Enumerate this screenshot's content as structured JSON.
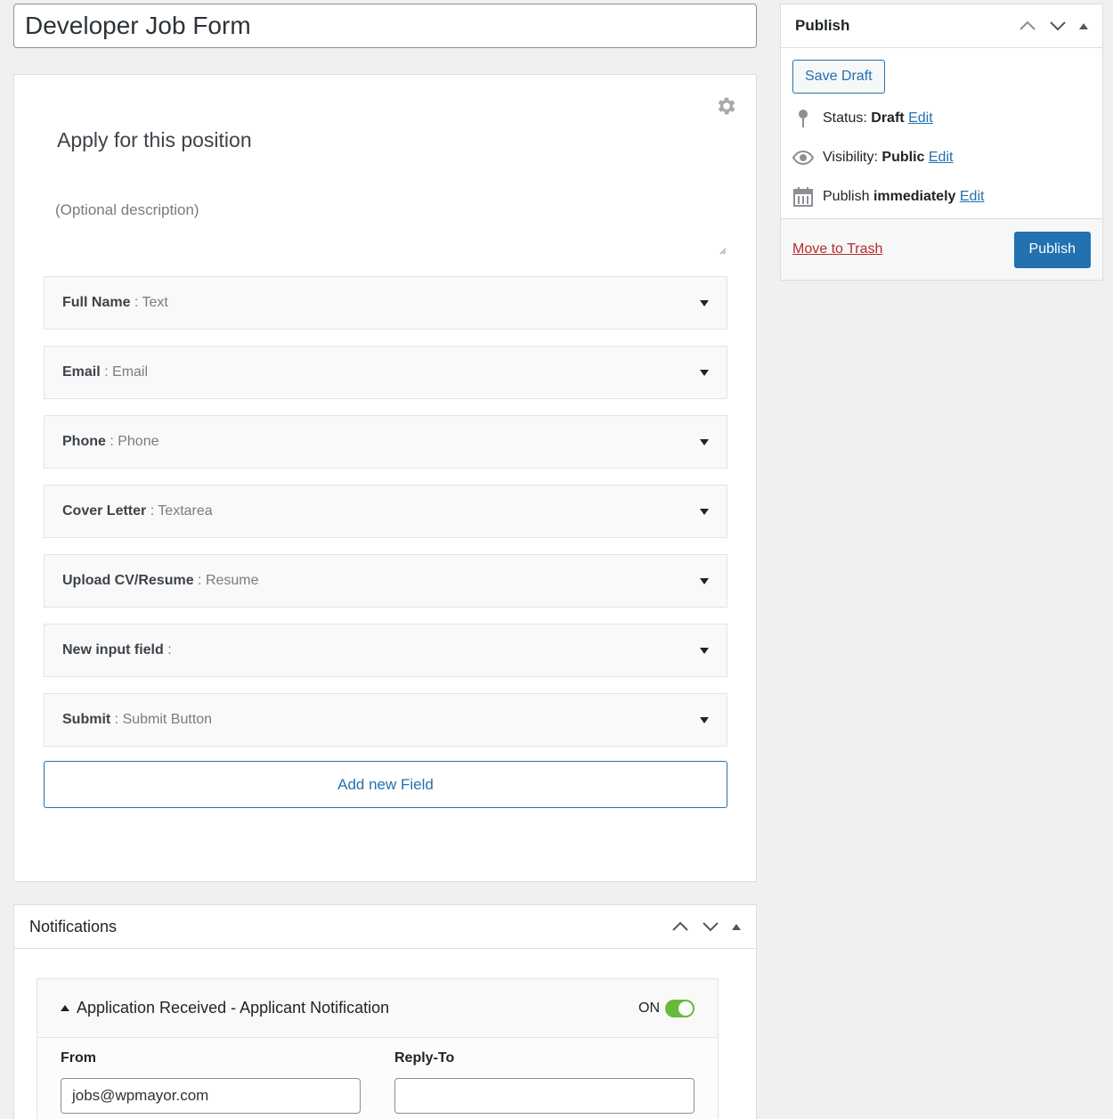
{
  "post_title": "Developer Job Form",
  "form": {
    "heading": "Apply for this position",
    "description_placeholder": "(Optional description)",
    "fields": [
      {
        "name": "Full Name",
        "separator": " : ",
        "type": "Text"
      },
      {
        "name": "Email",
        "separator": " : ",
        "type": "Email"
      },
      {
        "name": "Phone",
        "separator": " : ",
        "type": "Phone"
      },
      {
        "name": "Cover Letter",
        "separator": " : ",
        "type": "Textarea"
      },
      {
        "name": "Upload CV/Resume",
        "separator": " : ",
        "type": "Resume"
      },
      {
        "name": "New input field",
        "separator": " :",
        "type": ""
      },
      {
        "name": "Submit",
        "separator": " : ",
        "type": "Submit Button"
      }
    ],
    "add_field_label": "Add new Field"
  },
  "notifications": {
    "title": "Notifications",
    "item": {
      "title": "Application Received - Applicant Notification",
      "toggle_label": "ON",
      "from_label": "From",
      "from_value": "jobs@wpmayor.com",
      "reply_to_label": "Reply-To",
      "reply_to_value": ""
    }
  },
  "publish": {
    "title": "Publish",
    "save_draft": "Save Draft",
    "status_label": "Status:",
    "status_value": "Draft",
    "visibility_label": "Visibility:",
    "visibility_value": "Public",
    "schedule_label": "Publish",
    "schedule_value": "immediately",
    "edit_link": "Edit",
    "move_to_trash": "Move to Trash",
    "publish_button": "Publish"
  },
  "colors": {
    "accent": "#2271b1",
    "trash": "#b32d2e",
    "toggle_on": "#66bb3a"
  },
  "icons": [
    "gear-icon",
    "pin-icon",
    "eye-icon",
    "calendar-icon",
    "chevron-up-icon",
    "chevron-down-icon",
    "toggle-arrow-icon",
    "caret-down-icon"
  ]
}
